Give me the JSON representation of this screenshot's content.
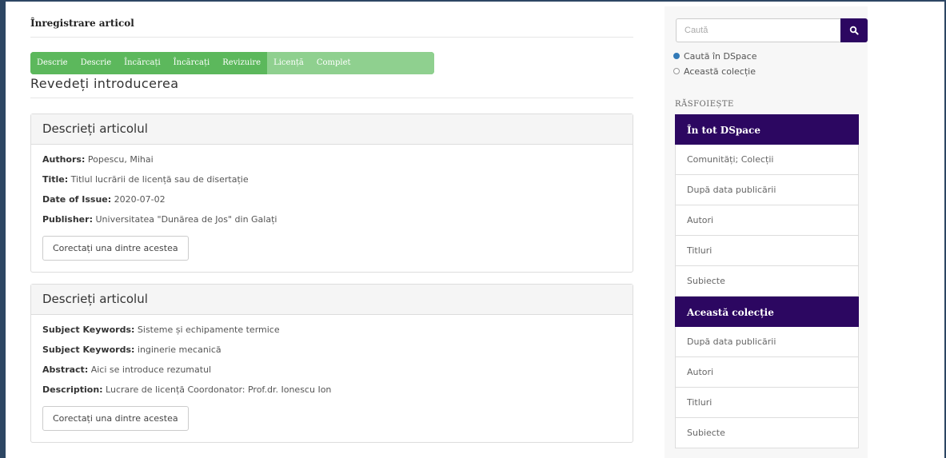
{
  "page": {
    "heading": "Înregistrare articol",
    "review_title": "Revedeți introducerea"
  },
  "progress": {
    "steps": [
      "Descrie",
      "Descrie",
      "Încărcați",
      "Încărcați",
      "Revizuire",
      "Licență",
      "Complet"
    ]
  },
  "panels": [
    {
      "title": "Descrieți articolul",
      "fields": [
        {
          "key": "Authors:",
          "value": "Popescu, Mihai"
        },
        {
          "key": "Title:",
          "value": "Titlul lucrării de licență sau de disertație"
        },
        {
          "key": "Date of Issue:",
          "value": "2020-07-02"
        },
        {
          "key": "Publisher:",
          "value": "Universitatea \"Dunărea de Jos\" din Galați"
        }
      ],
      "button": "Corectați una dintre acestea"
    },
    {
      "title": "Descrieți articolul",
      "fields": [
        {
          "key": "Subject Keywords:",
          "value": "Sisteme și echipamente termice"
        },
        {
          "key": "Subject Keywords:",
          "value": "inginerie mecanică"
        },
        {
          "key": "Abstract:",
          "value": "Aici se introduce rezumatul"
        },
        {
          "key": "Description:",
          "value": "Lucrare de licență Coordonator: Prof.dr. Ionescu Ion"
        }
      ],
      "button": "Corectați una dintre acestea"
    }
  ],
  "sidebar": {
    "search_placeholder": "Caută",
    "radios": [
      {
        "label": "Caută în DSpace",
        "checked": true
      },
      {
        "label": "Această colecție",
        "checked": false
      }
    ],
    "browse_heading": "RĂSFOIEȘTE",
    "groups": [
      {
        "header": "În tot DSpace",
        "items": [
          "Comunități; Colecții",
          "După data publicării",
          "Autori",
          "Titluri",
          "Subiecte"
        ]
      },
      {
        "header": "Această colecție",
        "items": [
          "După data publicării",
          "Autori",
          "Titluri",
          "Subiecte"
        ]
      }
    ]
  },
  "colors": {
    "progress_green": "#5cb85c",
    "progress_active": "#8fd08f",
    "sidebar_accent": "#2c0761",
    "frame": "#2d4663"
  },
  "icons": {
    "search_button": "search-icon"
  }
}
